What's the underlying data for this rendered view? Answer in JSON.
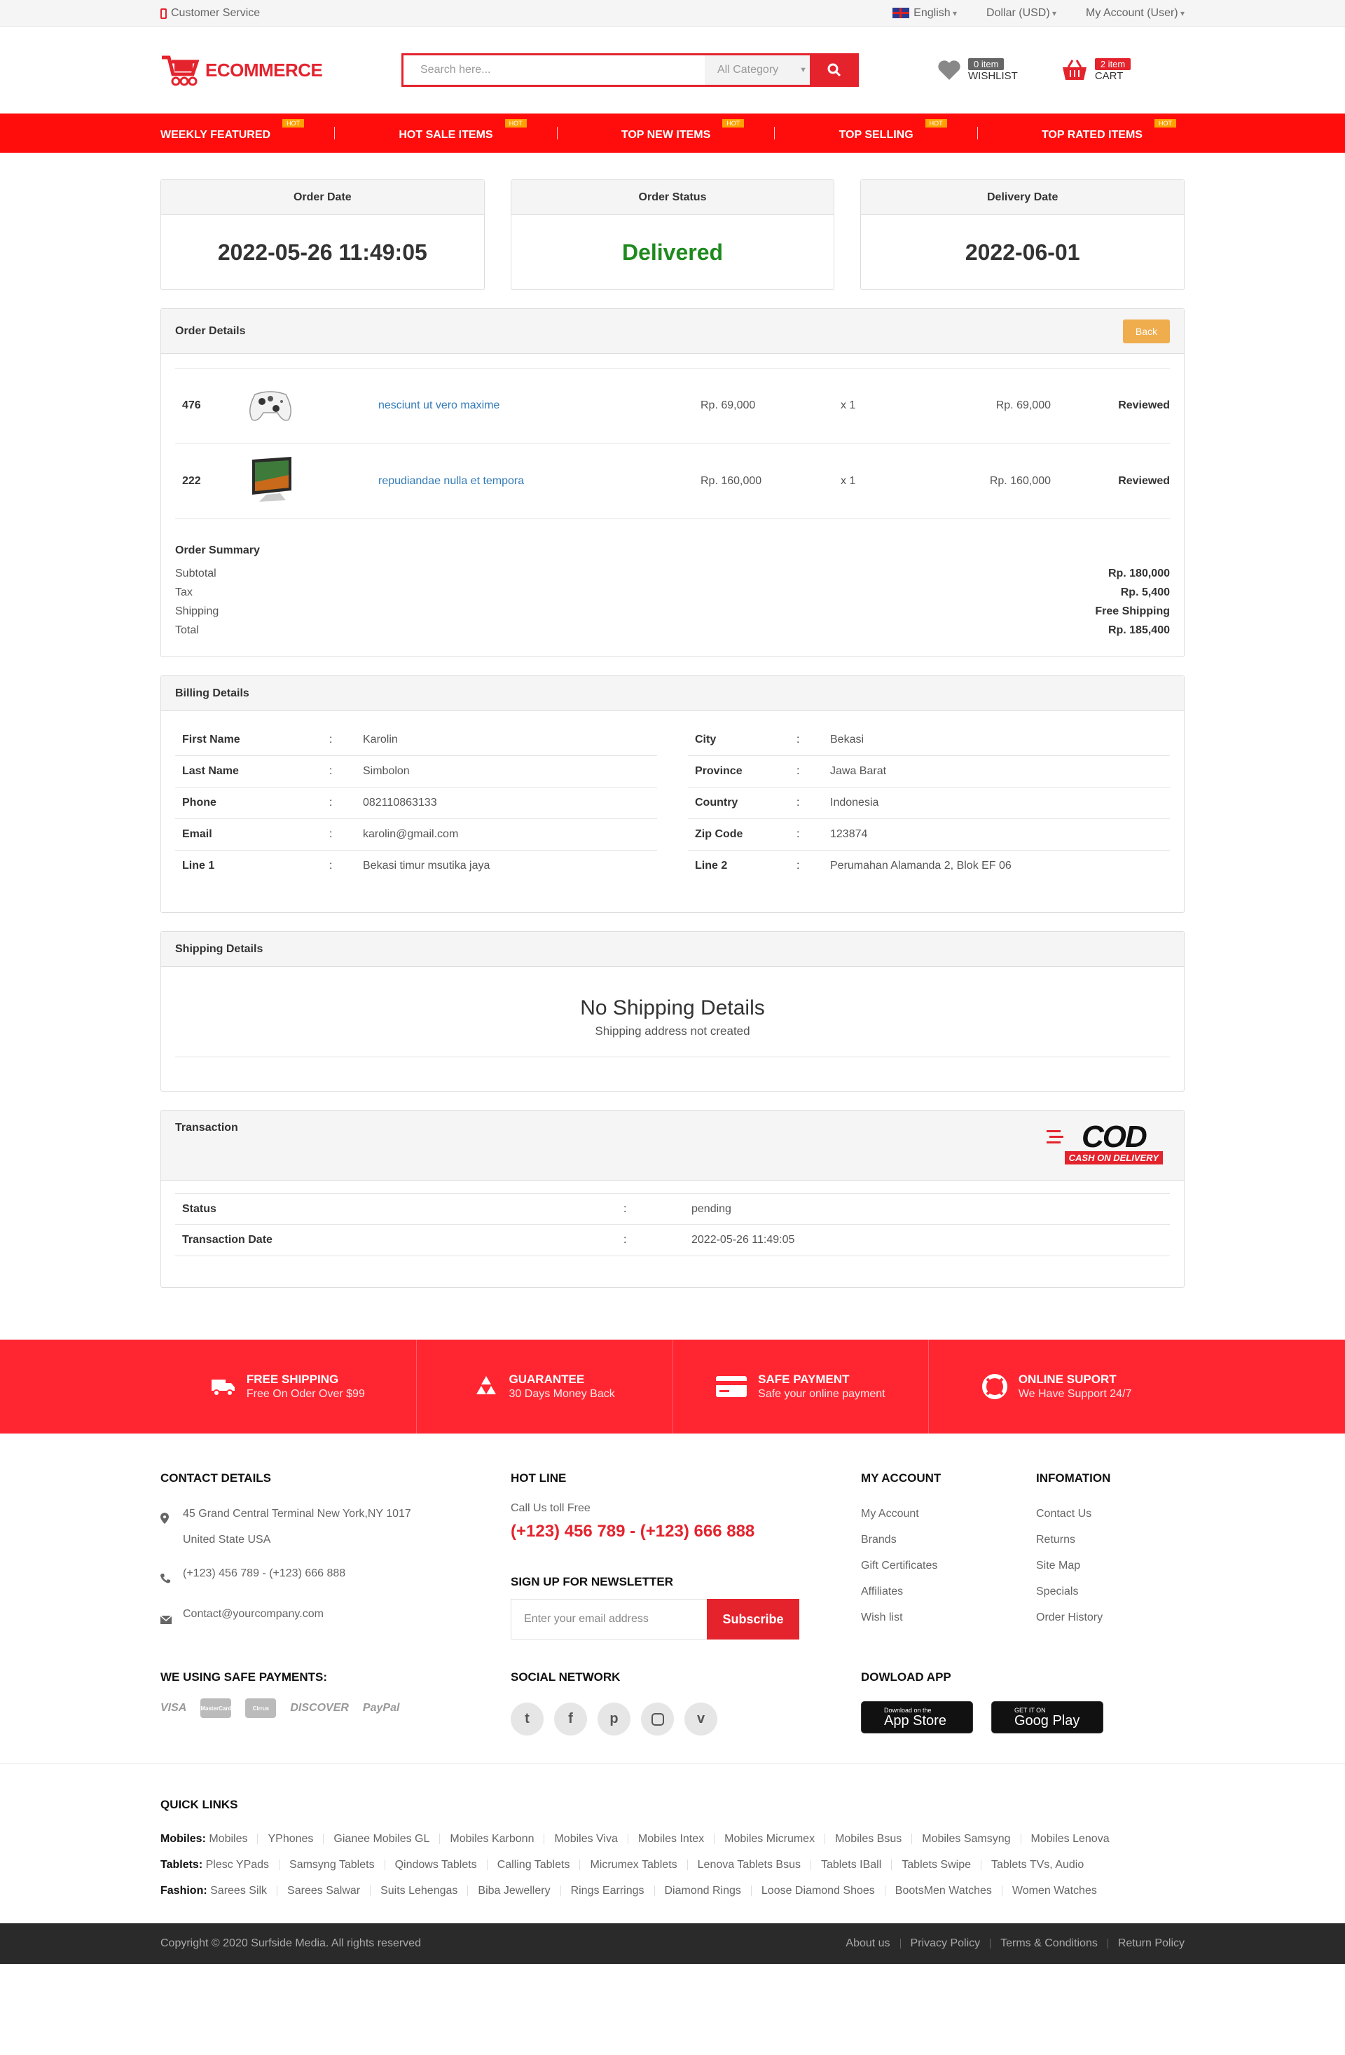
{
  "topbar": {
    "customer_service": "Customer Service",
    "language": "English",
    "currency": "Dollar (USD)",
    "account": "My Account (User)"
  },
  "header": {
    "logo_text": "ECOMMERCE",
    "search_placeholder": "Search here...",
    "category": "All Category",
    "wishlist_count": "0 item",
    "wishlist_label": "WISHLIST",
    "cart_count": "2 item",
    "cart_label": "CART"
  },
  "nav": {
    "items": [
      {
        "label": "WEEKLY FEATURED",
        "badge": "HOT"
      },
      {
        "label": "HOT SALE ITEMS",
        "badge": "HOT"
      },
      {
        "label": "TOP NEW ITEMS",
        "badge": "HOT"
      },
      {
        "label": "TOP SELLING",
        "badge": "HOT"
      },
      {
        "label": "TOP RATED ITEMS",
        "badge": "HOT"
      }
    ]
  },
  "status_boxes": {
    "order_date_label": "Order Date",
    "order_date": "2022-05-26 11:49:05",
    "order_status_label": "Order Status",
    "order_status": "Delivered",
    "delivery_date_label": "Delivery Date",
    "delivery_date": "2022-06-01"
  },
  "order_details": {
    "title": "Order Details",
    "back_label": "Back",
    "items": [
      {
        "id": "476",
        "name": "nesciunt ut vero maxime",
        "price": "Rp. 69,000",
        "qty": "x 1",
        "total": "Rp. 69,000",
        "status": "Reviewed",
        "icon": "gamepad-icon"
      },
      {
        "id": "222",
        "name": "repudiandae nulla et tempora",
        "price": "Rp. 160,000",
        "qty": "x 1",
        "total": "Rp. 160,000",
        "status": "Reviewed",
        "icon": "monitor-icon"
      }
    ],
    "summary_title": "Order Summary",
    "summary": {
      "subtotal_label": "Subtotal",
      "subtotal": "Rp. 180,000",
      "tax_label": "Tax",
      "tax": "Rp. 5,400",
      "shipping_label": "Shipping",
      "shipping": "Free Shipping",
      "total_label": "Total",
      "total": "Rp. 185,400"
    }
  },
  "billing": {
    "title": "Billing Details",
    "left": [
      {
        "k": "First Name",
        "v": "Karolin"
      },
      {
        "k": "Last Name",
        "v": "Simbolon"
      },
      {
        "k": "Phone",
        "v": "082110863133"
      },
      {
        "k": "Email",
        "v": "karolin@gmail.com"
      },
      {
        "k": "Line 1",
        "v": "Bekasi timur msutika jaya"
      }
    ],
    "right": [
      {
        "k": "City",
        "v": "Bekasi"
      },
      {
        "k": "Province",
        "v": "Jawa Barat"
      },
      {
        "k": "Country",
        "v": "Indonesia"
      },
      {
        "k": "Zip Code",
        "v": "123874"
      },
      {
        "k": "Line 2",
        "v": "Perumahan Alamanda 2, Blok EF 06"
      }
    ],
    "colon": ":"
  },
  "shipping": {
    "title": "Shipping Details",
    "empty_title": "No Shipping Details",
    "empty_sub": "Shipping address not created"
  },
  "transaction": {
    "title": "Transaction",
    "logo_main": "COD",
    "logo_sub": "CASH ON DELIVERY",
    "rows": [
      {
        "k": "Status",
        "v": "pending"
      },
      {
        "k": "Transaction Date",
        "v": "2022-05-26 11:49:05"
      }
    ],
    "colon": ":"
  },
  "features": [
    {
      "title": "FREE SHIPPING",
      "sub": "Free On Oder Over $99",
      "icon": "truck-icon"
    },
    {
      "title": "GUARANTEE",
      "sub": "30 Days Money Back",
      "icon": "recycle-icon"
    },
    {
      "title": "SAFE PAYMENT",
      "sub": "Safe your online payment",
      "icon": "credit-card-icon"
    },
    {
      "title": "ONLINE SUPORT",
      "sub": "We Have Support 24/7",
      "icon": "lifebuoy-icon"
    }
  ],
  "footer": {
    "contact_title": "CONTACT DETAILS",
    "address": "45 Grand Central Terminal New York,NY 1017",
    "address2": "United State USA",
    "phone": "(+123) 456 789 - (+123) 666 888",
    "email": "Contact@yourcompany.com",
    "hotline_title": "HOT LINE",
    "hotline_sub": "Call Us toll Free",
    "hotline_number": "(+123) 456 789 - (+123) 666 888",
    "newsletter_title": "SIGN UP FOR NEWSLETTER",
    "newsletter_placeholder": "Enter your email address",
    "subscribe_label": "Subscribe",
    "account_title": "MY ACCOUNT",
    "account_links": [
      "My Account",
      "Brands",
      "Gift Certificates",
      "Affiliates",
      "Wish list"
    ],
    "info_title": "INFOMATION",
    "info_links": [
      "Contact Us",
      "Returns",
      "Site Map",
      "Specials",
      "Order History"
    ],
    "payments_title": "WE USING SAFE PAYMENTS:",
    "payments": [
      "VISA",
      "MasterCard",
      "Cirrus",
      "DISCOVER",
      "PayPal"
    ],
    "social_title": "SOCIAL NETWORK",
    "social": [
      "twitter-icon",
      "facebook-icon",
      "pinterest-icon",
      "instagram-icon",
      "vimeo-icon"
    ],
    "app_title": "DOWLOAD APP",
    "appstore_small": "Download on the",
    "appstore_big": "App Store",
    "googleplay_small": "GET IT ON",
    "googleplay_big": "Goog Play"
  },
  "quick_links": {
    "title": "QUICK LINKS",
    "rows": [
      {
        "label": "Mobiles:",
        "items": [
          "Mobiles",
          "YPhones",
          "Gianee Mobiles GL",
          "Mobiles Karbonn",
          "Mobiles Viva",
          "Mobiles Intex",
          "Mobiles Micrumex",
          "Mobiles Bsus",
          "Mobiles Samsyng",
          "Mobiles Lenova"
        ]
      },
      {
        "label": "Tablets:",
        "items": [
          "Plesc YPads",
          "Samsyng Tablets",
          "Qindows Tablets",
          "Calling Tablets",
          "Micrumex Tablets",
          "Lenova Tablets Bsus",
          "Tablets IBall",
          "Tablets Swipe",
          "Tablets TVs, Audio"
        ]
      },
      {
        "label": "Fashion:",
        "items": [
          "Sarees Silk",
          "Sarees Salwar",
          "Suits Lehengas",
          "Biba Jewellery",
          "Rings Earrings",
          "Diamond Rings",
          "Loose Diamond Shoes",
          "BootsMen Watches",
          "Women Watches"
        ]
      }
    ]
  },
  "bottom": {
    "copyright": "Copyright © 2020 Surfside Media. All rights reserved",
    "links": [
      "About us",
      "Privacy Policy",
      "Terms & Conditions",
      "Return Policy"
    ]
  }
}
